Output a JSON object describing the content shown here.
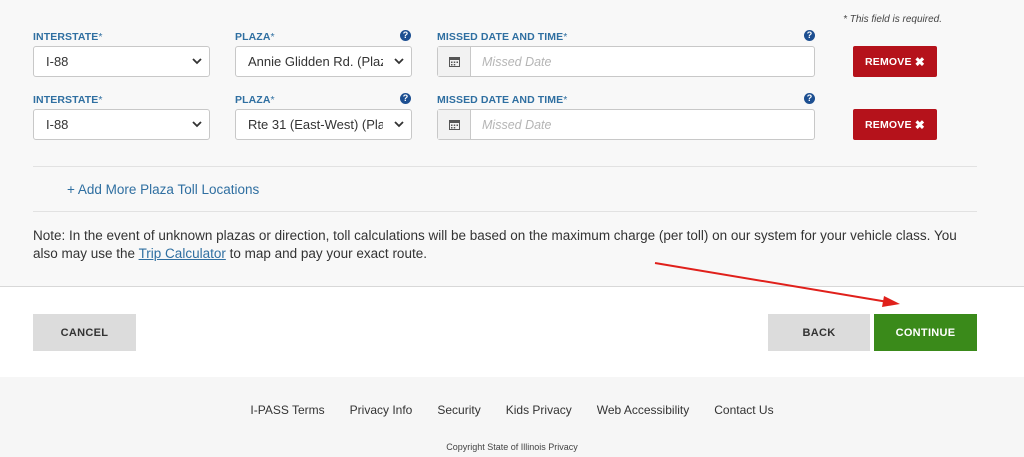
{
  "form": {
    "required_note": "* This field is required.",
    "rows": [
      {
        "interstate_label": "INTERSTATE",
        "plaza_label": "PLAZA",
        "date_label": "MISSED DATE AND TIME",
        "interstate_value": "I-88",
        "plaza_value": "Annie Glidden Rd. (Plaza",
        "date_placeholder": "Missed Date",
        "remove_label": "REMOVE"
      },
      {
        "interstate_label": "INTERSTATE",
        "plaza_label": "PLAZA",
        "date_label": "MISSED DATE AND TIME",
        "interstate_value": "I-88",
        "plaza_value": "Rte 31 (East-West) (Plaza",
        "date_placeholder": "Missed Date",
        "remove_label": "REMOVE"
      }
    ],
    "asterisk": "*",
    "help_glyph": "?",
    "add_more": "+ Add More Plaza Toll Locations",
    "note_before": "Note: In the event of unknown plazas or direction, toll calculations will be based on the maximum charge (per toll) on our system for your vehicle class. You also may use the ",
    "note_link": "Trip Calculator",
    "note_after": " to map and pay your exact route."
  },
  "actions": {
    "cancel": "CANCEL",
    "back": "BACK",
    "continue": "CONTINUE"
  },
  "footer": {
    "links": [
      "I-PASS Terms",
      "Privacy Info",
      "Security",
      "Kids Privacy",
      "Web Accessibility",
      "Contact Us"
    ],
    "copyright": "Copyright State of Illinois Privacy"
  },
  "colors": {
    "label_blue": "#2f6fa1",
    "remove_red": "#b5121b",
    "continue_green": "#3a8a1a",
    "annotation_arrow": "#e0201b"
  },
  "icons": [
    "help-icon",
    "chevron-down-icon",
    "calendar-icon",
    "close-icon"
  ]
}
